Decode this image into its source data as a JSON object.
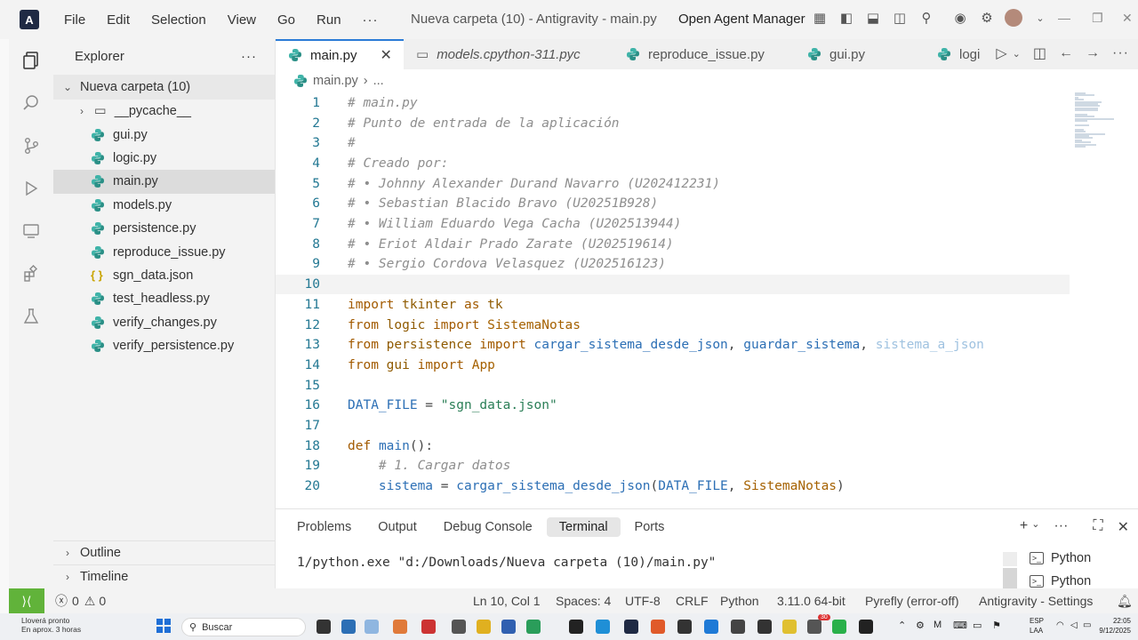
{
  "titlebar": {
    "menu": [
      "File",
      "Edit",
      "Selection",
      "View",
      "Go",
      "Run"
    ],
    "more": "···",
    "window_title": "Nueva carpeta (10) - Antigravity - main.py",
    "agent_manager": "Open Agent Manager"
  },
  "sidebar": {
    "title": "Explorer",
    "more": "···",
    "folder": "Nueva carpeta (10)",
    "items": [
      {
        "label": "__pycache__",
        "type": "folder"
      },
      {
        "label": "gui.py",
        "type": "py"
      },
      {
        "label": "logic.py",
        "type": "py"
      },
      {
        "label": "main.py",
        "type": "py",
        "active": true
      },
      {
        "label": "models.py",
        "type": "py"
      },
      {
        "label": "persistence.py",
        "type": "py"
      },
      {
        "label": "reproduce_issue.py",
        "type": "py"
      },
      {
        "label": "sgn_data.json",
        "type": "json"
      },
      {
        "label": "test_headless.py",
        "type": "py"
      },
      {
        "label": "verify_changes.py",
        "type": "py"
      },
      {
        "label": "verify_persistence.py",
        "type": "py"
      }
    ],
    "outline": "Outline",
    "timeline": "Timeline"
  },
  "tabs": [
    {
      "label": "main.py",
      "active": true
    },
    {
      "label": "models.cpython-311.pyc",
      "italic": true
    },
    {
      "label": "reproduce_issue.py"
    },
    {
      "label": "gui.py"
    },
    {
      "label": "logi"
    }
  ],
  "breadcrumb": {
    "file": "main.py",
    "rest": "..."
  },
  "code": {
    "current_line": 10,
    "lines": [
      {
        "n": "1",
        "t": "# main.py"
      },
      {
        "n": "2",
        "t": "# Punto de entrada de la aplicación"
      },
      {
        "n": "3",
        "t": "#"
      },
      {
        "n": "4",
        "t": "# Creado por:"
      },
      {
        "n": "5",
        "t": "# • Johnny Alexander Durand Navarro (U202412231)"
      },
      {
        "n": "6",
        "t": "# • Sebastian Blacido Bravo (U20251B928)"
      },
      {
        "n": "7",
        "t": "# • William Eduardo Vega Cacha (U202513944)"
      },
      {
        "n": "8",
        "t": "# • Eriot Aldair Prado Zarate (U202519614)"
      },
      {
        "n": "9",
        "t": "# • Sergio Cordova Velasquez (U202516123)"
      },
      {
        "n": "10",
        "t": ""
      },
      {
        "n": "11",
        "k": "import",
        "a": "tkinter",
        "b": "as",
        "c": "tk"
      },
      {
        "n": "12",
        "k": "from",
        "a": "logic",
        "b": "import",
        "c": "SistemaNotas"
      },
      {
        "n": "13",
        "k": "from",
        "a": "persistence",
        "b": "import",
        "c": "cargar_sistema_desde_json",
        "d": ", ",
        "e": "guardar_sistema",
        "f": ", ",
        "g": "sistema_a_json"
      },
      {
        "n": "14",
        "k": "from",
        "a": "gui",
        "b": "import",
        "c": "App"
      },
      {
        "n": "15",
        "t": ""
      },
      {
        "n": "16",
        "v": "DATA_FILE",
        "eq": " = ",
        "s": "\"sgn_data.json\""
      },
      {
        "n": "17",
        "t": ""
      },
      {
        "n": "18",
        "k": "def",
        "fn": "main",
        "p": "():"
      },
      {
        "n": "19",
        "ind": "    ",
        "cm": "# 1. Cargar datos"
      },
      {
        "n": "20",
        "ind": "    ",
        "v": "sistema",
        "eq": " = ",
        "call": "cargar_sistema_desde_json",
        "o": "(",
        "arg1": "DATA_FILE",
        "sep": ", ",
        "arg2": "SistemaNotas",
        "cl": ")"
      }
    ]
  },
  "panel": {
    "tabs": [
      "Problems",
      "Output",
      "Debug Console",
      "Terminal",
      "Ports"
    ],
    "active_tab": "Terminal",
    "terminal_text": "1/python.exe \"d:/Downloads/Nueva carpeta (10)/main.py\"",
    "terminals": [
      "Python",
      "Python"
    ]
  },
  "statusbar": {
    "errors": "0",
    "warnings": "0",
    "position": "Ln 10, Col 1",
    "spaces": "Spaces: 4",
    "encoding": "UTF-8",
    "eol": "CRLF",
    "language": "Python",
    "interpreter": "3.11.0 64-bit",
    "pyrefly": "Pyrefly (error-off)",
    "settings": "Antigravity - Settings"
  },
  "taskbar": {
    "weather_title": "Lloverá pronto",
    "weather_sub": "En aprox. 3 horas",
    "search": "Buscar",
    "badge": "30",
    "lang1": "ESP",
    "lang2": "LAA",
    "time": "22:05",
    "date": "9/12/2025"
  },
  "colors": {
    "accent": "#2b7bd6",
    "remote": "#61b33a",
    "python_icon": "#3fb3a8"
  }
}
